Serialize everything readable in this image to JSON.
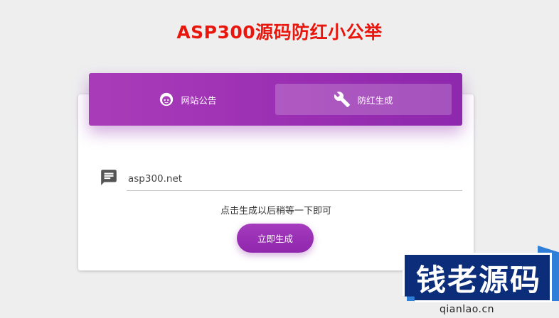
{
  "header": {
    "title": "ASP300源码防红小公举"
  },
  "tabs": [
    {
      "label": "网站公告",
      "icon": "smiley-face-icon",
      "active": false
    },
    {
      "label": "防红生成",
      "icon": "wrench-icon",
      "active": true
    }
  ],
  "form": {
    "url_value": "asp300.net",
    "hint": "点击生成以后稍等一下即可",
    "submit_label": "立即生成"
  },
  "watermark": {
    "brand": "钱老源码",
    "site": "qianlao.cn"
  },
  "colors": {
    "title": "#e8160c",
    "accent": "#9b2fb3",
    "watermark_blue": "#0c2d7a"
  }
}
